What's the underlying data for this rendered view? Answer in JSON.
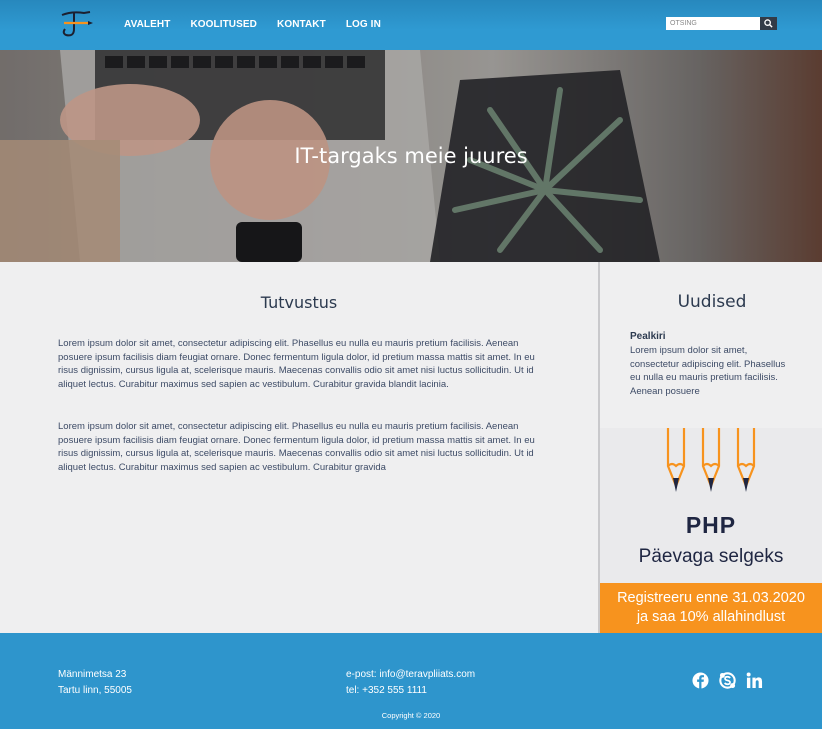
{
  "header": {
    "nav": [
      "AVALEHT",
      "KOOLITUSED",
      "KONTAKT",
      "LOG IN"
    ],
    "search_placeholder": "OTSING"
  },
  "hero": {
    "title": "IT-targaks meie juures"
  },
  "main": {
    "title": "Tutvustus",
    "paragraphs": [
      "Lorem ipsum dolor sit amet, consectetur adipiscing elit. Phasellus eu nulla eu mauris pretium facilisis. Aenean posuere ipsum facilisis diam feugiat ornare. Donec fermentum ligula dolor, id pretium massa mattis sit amet. In eu risus dignissim, cursus ligula at, scelerisque mauris. Maecenas convallis odio sit amet nisi luctus sollicitudin. Ut id aliquet lectus. Curabitur maximus sed sapien ac vestibulum. Curabitur gravida blandit lacinia.",
      "Lorem ipsum dolor sit amet, consectetur adipiscing elit. Phasellus eu nulla eu mauris pretium facilisis. Aenean posuere ipsum facilisis diam feugiat ornare. Donec fermentum ligula dolor, id pretium massa mattis sit amet. In eu risus dignissim, cursus ligula at, scelerisque mauris. Maecenas convallis odio sit amet nisi luctus sollicitudin. Ut id aliquet lectus. Curabitur maximus sed sapien ac vestibulum. Curabitur gravida"
    ]
  },
  "sidebar": {
    "title": "Uudised",
    "news_title": "Pealkiri",
    "news_text": "Lorem ipsum dolor sit amet, consectetur adipiscing elit. Phasellus eu nulla eu mauris pretium facilisis. Aenean posuere",
    "ad": {
      "headline": "PHP",
      "subline": "Päevaga selgeks",
      "cta_line1": "Registreeru enne 31.03.2020",
      "cta_line2": "ja saa 10% allahindlust"
    }
  },
  "footer": {
    "address_line1": "Männimetsa 23",
    "address_line2": "Tartu linn, 55005",
    "email": "e-post: info@teravpliiats.com",
    "phone": "tel: +352 555 1111",
    "copyright": "Copyright © 2020",
    "social_icons": [
      "facebook-icon",
      "skype-icon",
      "linkedin-icon"
    ]
  },
  "colors": {
    "header_blue": "#2f9ad2",
    "footer_blue": "#2e95cc",
    "cta_orange": "#f7931e",
    "heading_navy": "#2c3a4f"
  }
}
